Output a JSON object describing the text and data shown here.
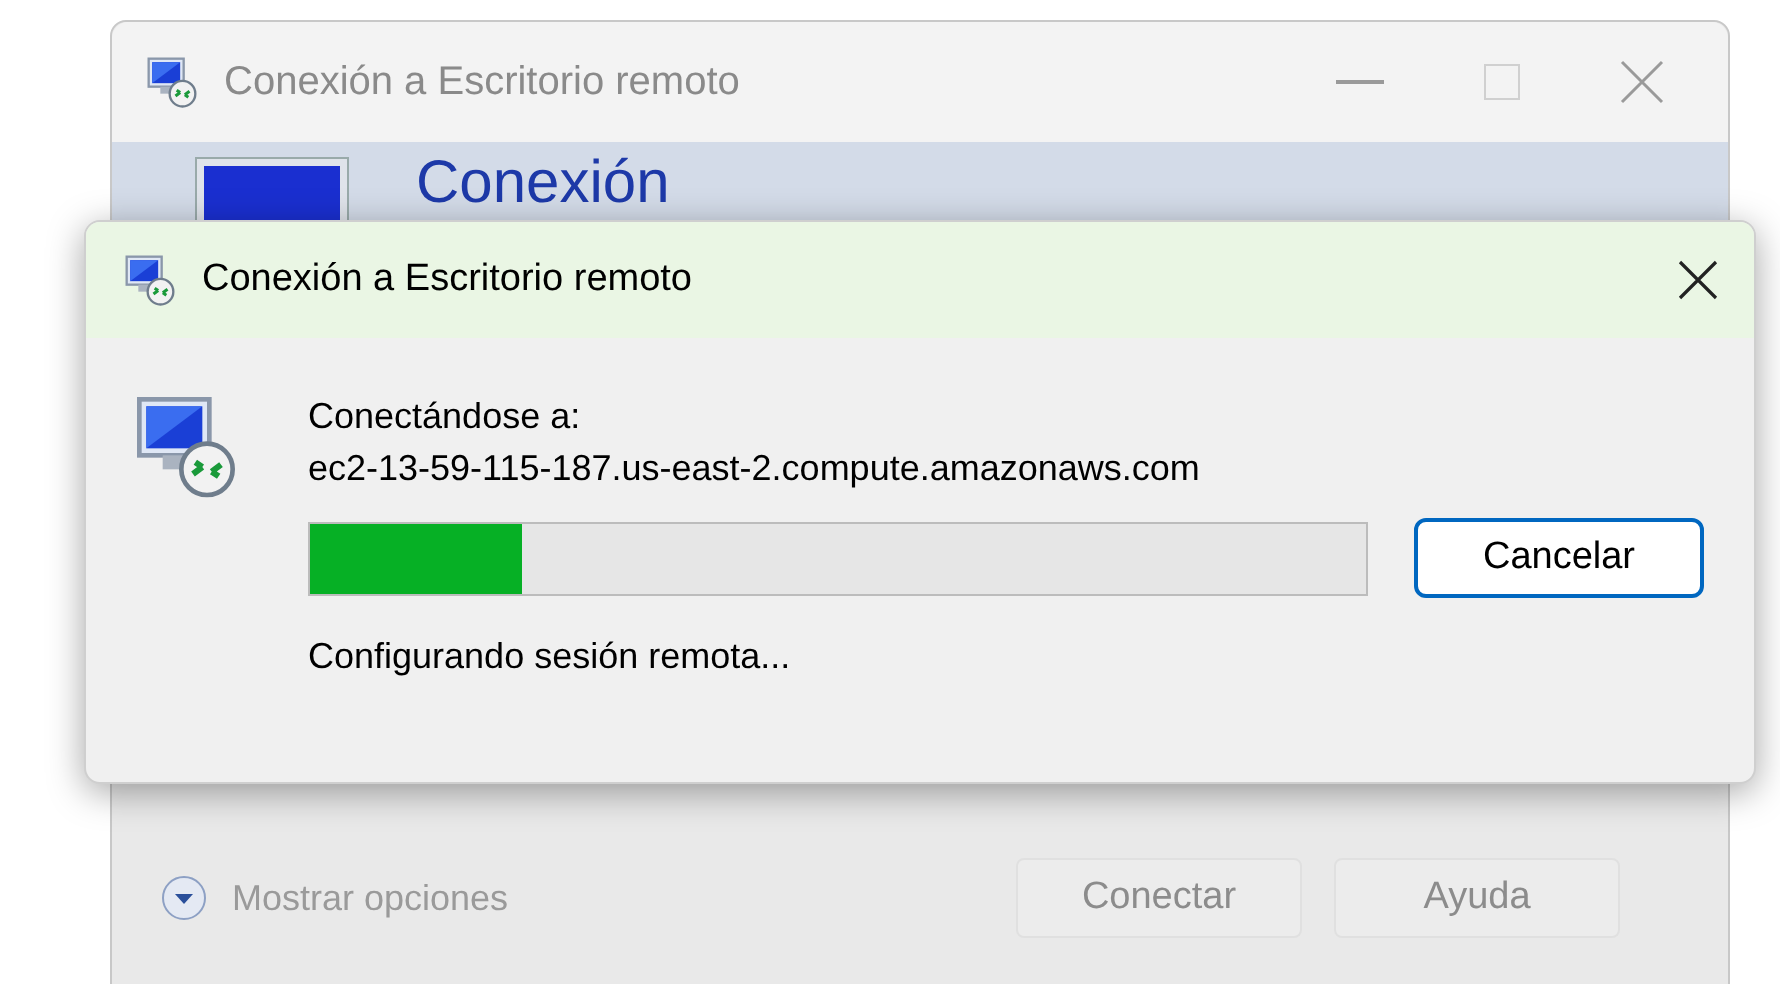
{
  "back_window": {
    "title": "Conexión a Escritorio remoto",
    "banner_title": "Conexión",
    "options_link": "Mostrar opciones",
    "buttons": [
      {
        "label": "Conectar",
        "disabled": true
      },
      {
        "label": "Ayuda",
        "disabled": true
      }
    ]
  },
  "dialog": {
    "title": "Conexión a Escritorio remoto",
    "heading": "Conectándose a:",
    "host": "ec2-13-59-115-187.us-east-2.compute.amazonaws.com",
    "progress": {
      "level": 0.2
    },
    "cancel_button": "Cancelar",
    "status": "Configurando sesión remota..."
  }
}
